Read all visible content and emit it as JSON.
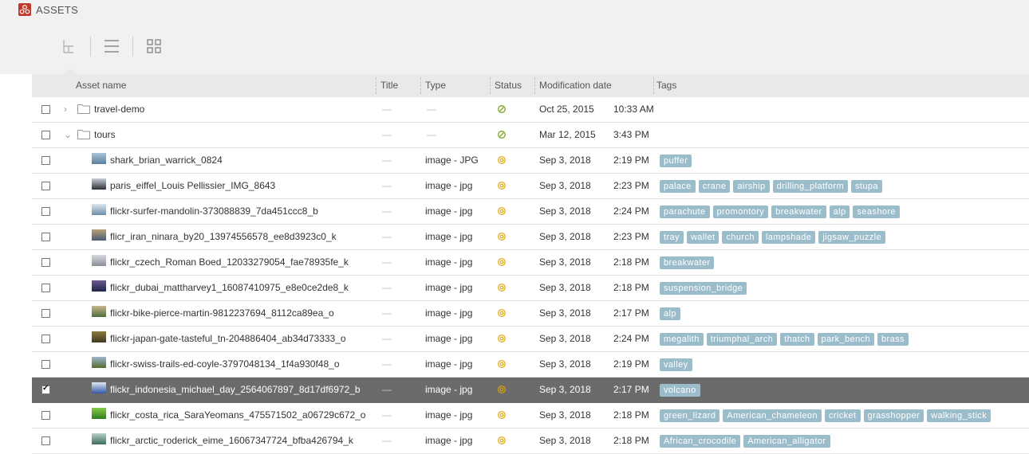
{
  "app": {
    "title": "ASSETS"
  },
  "toolbar": {
    "views": [
      {
        "icon": "column-view-icon",
        "active": true
      },
      {
        "icon": "list-view-icon",
        "active": false
      },
      {
        "icon": "grid-view-icon",
        "active": false
      }
    ]
  },
  "table": {
    "columns": [
      "Asset name",
      "Title",
      "Type",
      "Status",
      "Modification date",
      "Tags"
    ],
    "placeholder": "—",
    "rows": [
      {
        "kind": "folder",
        "expand": "collapsed",
        "name": "travel-demo",
        "title": "—",
        "type": "—",
        "status": "published",
        "date": "Oct 25, 2015",
        "time": "10:33 AM",
        "tags": [],
        "checked": false,
        "selected": false
      },
      {
        "kind": "folder",
        "expand": "expanded",
        "name": "tours",
        "title": "—",
        "type": "—",
        "status": "published",
        "date": "Mar 12, 2015",
        "time": "3:43 PM",
        "tags": [],
        "checked": false,
        "selected": false
      },
      {
        "kind": "image",
        "thumb": [
          "#5c7f9f",
          "#aac3d6"
        ],
        "name": "shark_brian_warrick_0824",
        "title": "—",
        "type": "image - JPG",
        "status": "draft",
        "date": "Sep 3, 2018",
        "time": "2:19 PM",
        "tags": [
          "puffer"
        ],
        "checked": false,
        "selected": false
      },
      {
        "kind": "image",
        "thumb": [
          "#2b2f36",
          "#c9ced6"
        ],
        "name": "paris_eiffel_Louis Pellissier_IMG_8643",
        "title": "—",
        "type": "image - jpg",
        "status": "draft",
        "date": "Sep 3, 2018",
        "time": "2:23 PM",
        "tags": [
          "palace",
          "crane",
          "airship",
          "drilling_platform",
          "stupa"
        ],
        "checked": false,
        "selected": false
      },
      {
        "kind": "image",
        "thumb": [
          "#6f8fab",
          "#dce6ee"
        ],
        "name": "flickr-surfer-mandolin-373088839_7da451ccc8_b",
        "title": "—",
        "type": "image - jpg",
        "status": "draft",
        "date": "Sep 3, 2018",
        "time": "2:24 PM",
        "tags": [
          "parachute",
          "promontory",
          "breakwater",
          "alp",
          "seashore"
        ],
        "checked": false,
        "selected": false
      },
      {
        "kind": "image",
        "thumb": [
          "#4a5a73",
          "#b8a27a"
        ],
        "name": "flicr_iran_ninara_by20_13974556578_ee8d3923c0_k",
        "title": "—",
        "type": "image - jpg",
        "status": "draft",
        "date": "Sep 3, 2018",
        "time": "2:23 PM",
        "tags": [
          "tray",
          "wallet",
          "church",
          "lampshade",
          "jigsaw_puzzle"
        ],
        "checked": false,
        "selected": false
      },
      {
        "kind": "image",
        "thumb": [
          "#8a8f99",
          "#d6d9de"
        ],
        "name": "flickr_czech_Roman Boed_12033279054_fae78935fe_k",
        "title": "—",
        "type": "image - jpg",
        "status": "draft",
        "date": "Sep 3, 2018",
        "time": "2:18 PM",
        "tags": [
          "breakwater"
        ],
        "checked": false,
        "selected": false
      },
      {
        "kind": "image",
        "thumb": [
          "#1d2447",
          "#6d5b8f"
        ],
        "name": "flickr_dubai_mattharvey1_16087410975_e8e0ce2de8_k",
        "title": "—",
        "type": "image - jpg",
        "status": "draft",
        "date": "Sep 3, 2018",
        "time": "2:18 PM",
        "tags": [
          "suspension_bridge"
        ],
        "checked": false,
        "selected": false
      },
      {
        "kind": "image",
        "thumb": [
          "#4f6b3c",
          "#c9b98a"
        ],
        "name": "flickr-bike-pierce-martin-9812237694_8112ca89ea_o",
        "title": "—",
        "type": "image - jpg",
        "status": "draft",
        "date": "Sep 3, 2018",
        "time": "2:17 PM",
        "tags": [
          "alp"
        ],
        "checked": false,
        "selected": false
      },
      {
        "kind": "image",
        "thumb": [
          "#3e3a22",
          "#8a7a3e"
        ],
        "name": "flickr-japan-gate-tasteful_tn-204886404_ab34d73333_o",
        "title": "—",
        "type": "image - jpg",
        "status": "draft",
        "date": "Sep 3, 2018",
        "time": "2:24 PM",
        "tags": [
          "megalith",
          "triumphal_arch",
          "thatch",
          "park_bench",
          "brass"
        ],
        "checked": false,
        "selected": false
      },
      {
        "kind": "image",
        "thumb": [
          "#556b2f",
          "#9fb7cf"
        ],
        "name": "flickr-swiss-trails-ed-coyle-3797048134_1f4a930f48_o",
        "title": "—",
        "type": "image - jpg",
        "status": "draft",
        "date": "Sep 3, 2018",
        "time": "2:19 PM",
        "tags": [
          "valley"
        ],
        "checked": false,
        "selected": false
      },
      {
        "kind": "image",
        "thumb": [
          "#3556a8",
          "#e0e7f3"
        ],
        "name": "flickr_indonesia_michael_day_2564067897_8d17df6972_b",
        "title": "—",
        "type": "image - jpg",
        "status": "draft",
        "date": "Sep 3, 2018",
        "time": "2:17 PM",
        "tags": [
          "volcano"
        ],
        "checked": true,
        "selected": true
      },
      {
        "kind": "image",
        "thumb": [
          "#2f7d1f",
          "#86c94a"
        ],
        "name": "flickr_costa_rica_SaraYeomans_475571502_a06729c672_o",
        "title": "—",
        "type": "image - jpg",
        "status": "draft",
        "date": "Sep 3, 2018",
        "time": "2:18 PM",
        "tags": [
          "green_lizard",
          "American_chameleon",
          "cricket",
          "grasshopper",
          "walking_stick"
        ],
        "checked": false,
        "selected": false
      },
      {
        "kind": "image",
        "thumb": [
          "#3c6b5a",
          "#b8d0c8"
        ],
        "name": "flickr_arctic_roderick_eime_16067347724_bfba426794_k",
        "title": "—",
        "type": "image - jpg",
        "status": "draft",
        "date": "Sep 3, 2018",
        "time": "2:18 PM",
        "tags": [
          "African_crocodile",
          "American_alligator"
        ],
        "checked": false,
        "selected": false
      }
    ]
  },
  "colors": {
    "brand": "#c0392b",
    "selected_row": "#6b6b6b",
    "tag": "#9bbccb",
    "status_published": "#7fa526",
    "status_draft": "#e0a400"
  }
}
